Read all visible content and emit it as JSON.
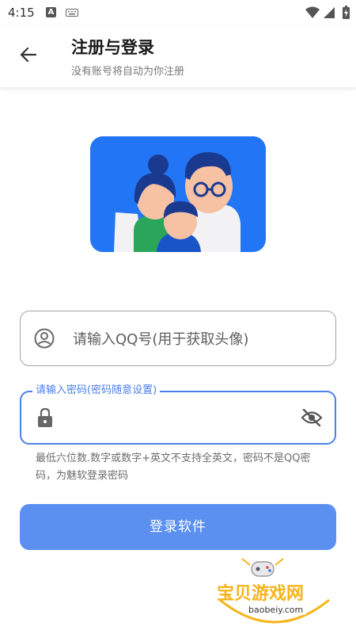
{
  "status_bar": {
    "time": "4:15",
    "notif_letter": "A"
  },
  "header": {
    "title": "注册与登录",
    "subtitle": "没有账号将自动为你注册"
  },
  "qq_field": {
    "placeholder": "请输入QQ号(用于获取头像)",
    "value": ""
  },
  "password_field": {
    "label": "请输入密码(密码随意设置)",
    "value": ""
  },
  "hint": "最低六位数.数字或数字+英文不支持全英文，密码不是QQ密码，为魅软登录密码",
  "login_button": {
    "label": "登录软件"
  },
  "watermark": {
    "text": "宝贝游戏网",
    "url": "baobeiy.com"
  },
  "colors": {
    "accent": "#4a80e8",
    "button": "#5b8ff0",
    "hero_bg": "#2276f5"
  }
}
